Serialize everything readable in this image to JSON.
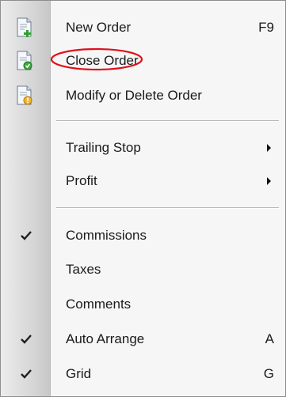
{
  "menu": {
    "items": [
      {
        "label": "New Order",
        "shortcut": "F9",
        "icon": "new-order-icon"
      },
      {
        "label": "Close Order",
        "icon": "close-order-icon"
      },
      {
        "label": "Modify or Delete Order",
        "icon": "modify-order-icon"
      },
      {
        "label": "Trailing Stop",
        "submenu": true
      },
      {
        "label": "Profit",
        "submenu": true
      },
      {
        "label": "Commissions",
        "checked": true
      },
      {
        "label": "Taxes",
        "checked": false
      },
      {
        "label": "Comments",
        "checked": false
      },
      {
        "label": "Auto Arrange",
        "shortcut": "A",
        "checked": true
      },
      {
        "label": "Grid",
        "shortcut": "G",
        "checked": true
      }
    ]
  },
  "colors": {
    "annotation_circle": "#e0101a",
    "check_mark": "#1f1f1f"
  }
}
